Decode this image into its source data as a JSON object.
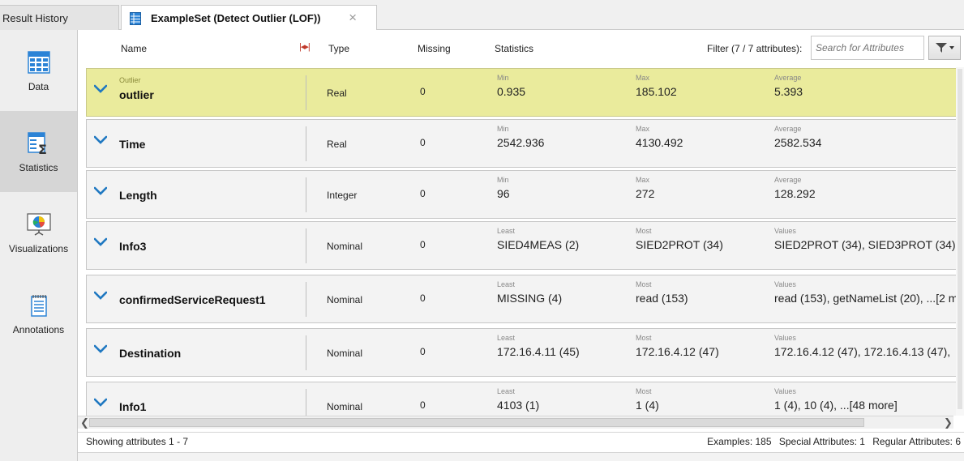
{
  "tabs": [
    {
      "label": "Result History"
    },
    {
      "label": "ExampleSet (Detect Outlier (LOF))",
      "close": "×"
    }
  ],
  "sidebar": {
    "items": [
      {
        "label": "Data",
        "icon": "table-icon"
      },
      {
        "label": "Statistics",
        "icon": "statistics-icon"
      },
      {
        "label": "Visualizations",
        "icon": "chart-icon"
      },
      {
        "label": "Annotations",
        "icon": "notepad-icon"
      }
    ],
    "active": "Statistics"
  },
  "header": {
    "name": "Name",
    "type": "Type",
    "missing": "Missing",
    "statistics": "Statistics",
    "filter_label": "Filter (7 / 7 attributes):",
    "search_placeholder": "Search for Attributes"
  },
  "attributes": [
    {
      "role": "Outlier",
      "name": "outlier",
      "type": "Real",
      "missing": "0",
      "s1_label": "Min",
      "s1": "0.935",
      "s2_label": "Max",
      "s2": "185.102",
      "s3_label": "Average",
      "s3": "5.393"
    },
    {
      "role": "",
      "name": "Time",
      "type": "Real",
      "missing": "0",
      "s1_label": "Min",
      "s1": "2542.936",
      "s2_label": "Max",
      "s2": "4130.492",
      "s3_label": "Average",
      "s3": "2582.534"
    },
    {
      "role": "",
      "name": "Length",
      "type": "Integer",
      "missing": "0",
      "s1_label": "Min",
      "s1": "96",
      "s2_label": "Max",
      "s2": "272",
      "s3_label": "Average",
      "s3": "128.292"
    },
    {
      "role": "",
      "name": "Info3",
      "type": "Nominal",
      "missing": "0",
      "s1_label": "Least",
      "s1": "SIED4MEAS (2)",
      "s2_label": "Most",
      "s2": "SIED2PROT (34)",
      "s3_label": "Values",
      "s3": "SIED2PROT (34), SIED3PROT (34)"
    },
    {
      "role": "",
      "name": "confirmedServiceRequest1",
      "type": "Nominal",
      "missing": "0",
      "s1_label": "Least",
      "s1": "MISSING (4)",
      "s2_label": "Most",
      "s2": "read (153)",
      "s3_label": "Values",
      "s3": "read (153), getNameList (20), ...[2 m"
    },
    {
      "role": "",
      "name": "Destination",
      "type": "Nominal",
      "missing": "0",
      "s1_label": "Least",
      "s1": "172.16.4.11 (45)",
      "s2_label": "Most",
      "s2": "172.16.4.12 (47)",
      "s3_label": "Values",
      "s3": "172.16.4.12 (47), 172.16.4.13 (47),"
    },
    {
      "role": "",
      "name": "Info1",
      "type": "Nominal",
      "missing": "0",
      "s1_label": "Least",
      "s1": "4103 (1)",
      "s2_label": "Most",
      "s2": "1 (4)",
      "s3_label": "Values",
      "s3": "1 (4), 10 (4), ...[48 more]"
    }
  ],
  "status": {
    "showing": "Showing attributes 1 - 7",
    "examples": "Examples: 185",
    "special": "Special Attributes: 1",
    "regular": "Regular Attributes: 6"
  },
  "colors": {
    "highlight_row": "#eaeb9c",
    "chevron": "#1f78c1"
  }
}
